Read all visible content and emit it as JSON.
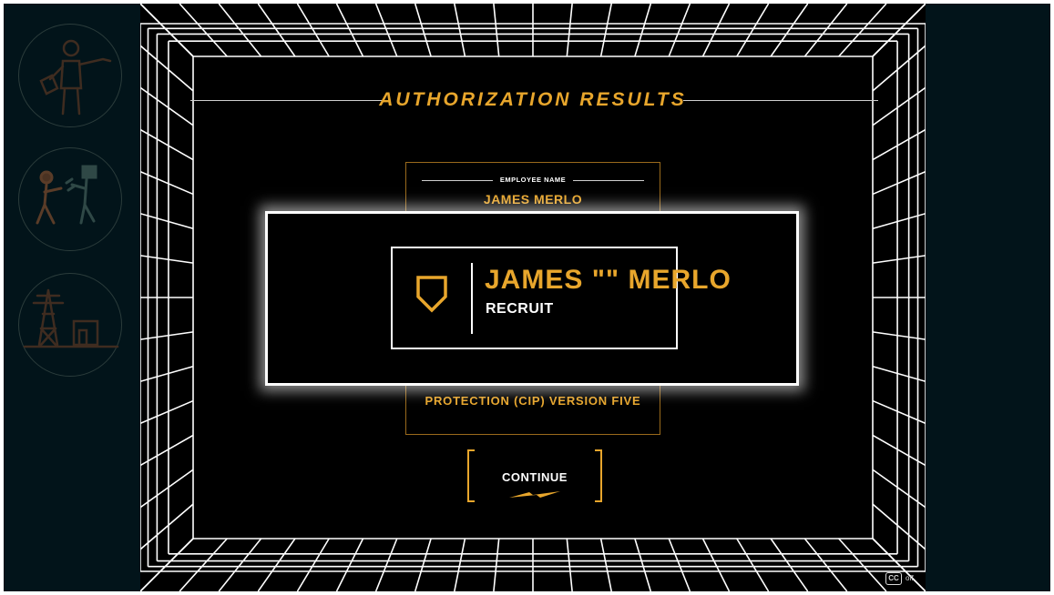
{
  "screen": {
    "title": "AUTHORIZATION RESULTS",
    "certificate": {
      "employee_name_label": "EMPLOYEE NAME",
      "employee_name_value": "JAMES MERLO",
      "footer_text": "PROTECTION (CIP) VERSION FIVE"
    },
    "badge": {
      "name": "JAMES \"\" MERLO",
      "rank": "RECRUIT"
    },
    "continue_label": "CONTINUE"
  },
  "captions": {
    "icon_text": "CC",
    "state": "off"
  },
  "sidebar": {
    "icons": [
      "worker-clipboard-icon",
      "worker-robot-icon",
      "power-tower-icon"
    ]
  },
  "colors": {
    "accent": "#e8a62c",
    "sidebar_bg": "#02141a",
    "stage_bg": "#000000",
    "grid": "#ffffff"
  }
}
